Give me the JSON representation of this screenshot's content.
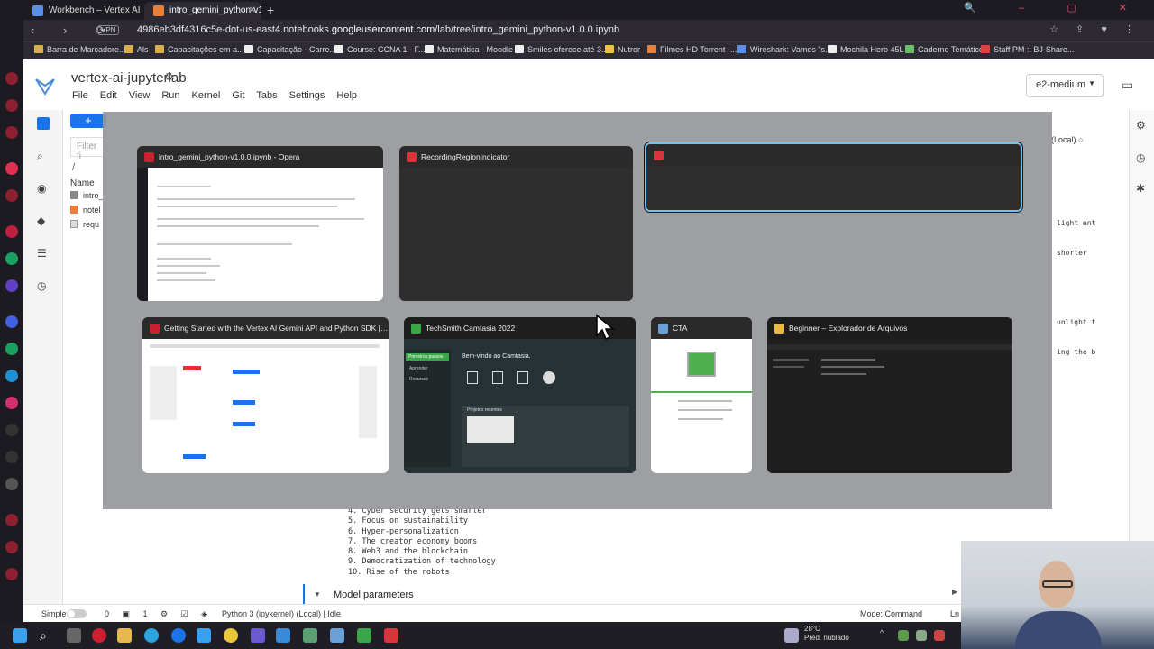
{
  "browser": {
    "tabs": [
      {
        "title": "Workbench – Vertex AI – ..."
      },
      {
        "title": "intro_gemini_python-v1.0...."
      }
    ],
    "new_tab": "+",
    "vpn": "VPN",
    "url_prefix": "4986eb3df4316c5e-dot-us-east4.notebooks.",
    "url_domain": "googleusercontent.com",
    "url_path": "/lab/tree/intro_gemini_python-v1.0.0.ipynb",
    "bookmarks": [
      "Barra de Marcadore...",
      "Als",
      "Capacitações em a...",
      "Capacitação - Carre...",
      "Course: CCNA 1 - F...",
      "Matemática - Moodle",
      "Smiles oferece até 3...",
      "Nutror",
      "Filmes HD Torrent -...",
      "Wireshark: Vamos \"s...",
      "Mochila Hero 45L",
      "Caderno Temático",
      "Staff PM :: BJ-Share..."
    ]
  },
  "jupyter": {
    "title": "vertex-ai-jupyterlab",
    "menu": [
      "File",
      "Edit",
      "View",
      "Run",
      "Kernel",
      "Git",
      "Tabs",
      "Settings",
      "Help"
    ],
    "machine": "e2-medium",
    "new_button": "+",
    "filter_placeholder": "Filter fi",
    "breadcrumb": "/",
    "name_header": "Name",
    "files": [
      "intro_",
      "notel",
      "requ"
    ],
    "kernel_local": "(Local)",
    "code_bits": [
      "light ent",
      "shorter",
      "",
      "",
      "unlight t",
      "ing the b"
    ],
    "notebook_list": [
      "4. Cyber security gets smarter",
      "5. Focus on sustainability",
      "6. Hyper-personalization",
      "7. The creator economy booms",
      "8. Web3 and the blockchain",
      "9. Democratization of technology",
      "10. Rise of the robots"
    ],
    "section_heading": "Model parameters",
    "status": {
      "simple": "Simple",
      "counts": "0",
      "counts2": "1",
      "kernel": "Python 3 (ipykernel) (Local) | Idle",
      "mode": "Mode: Command",
      "ln": "Ln"
    }
  },
  "switcher": {
    "windows": [
      {
        "title": "intro_gemini_python-v1.0.0.ipynb - Opera",
        "icon_color": "#cc1f2f"
      },
      {
        "title": "RecordingRegionIndicator",
        "icon_color": "#d6363a"
      },
      {
        "title": "",
        "icon_color": "#d6363a"
      },
      {
        "title": "Getting Started with the Vertex AI Gemini API and Python SDK | G...",
        "icon_color": "#cc1f2f"
      },
      {
        "title": "TechSmith Camtasia 2022",
        "icon_color": "#3aa64a"
      },
      {
        "title": "CTA",
        "icon_color": "#6aa0d8"
      },
      {
        "title": "Beginner – Explorador de Arquivos",
        "icon_color": "#e8b84a"
      }
    ],
    "camtasia_welcome": "Bem-vindo ao Camtasia.",
    "camtasia_menu": [
      "Primeiros passos",
      "Aprender",
      "Recursos"
    ],
    "camtasia_projects": "Projetos recentes"
  },
  "taskbar": {
    "temperature": "28°C",
    "weather": "Pred. nublado"
  },
  "colors": {
    "accent": "#1a73e8",
    "browser_dark": "#2d2a33",
    "selected_outline": "#6ec3f5"
  }
}
